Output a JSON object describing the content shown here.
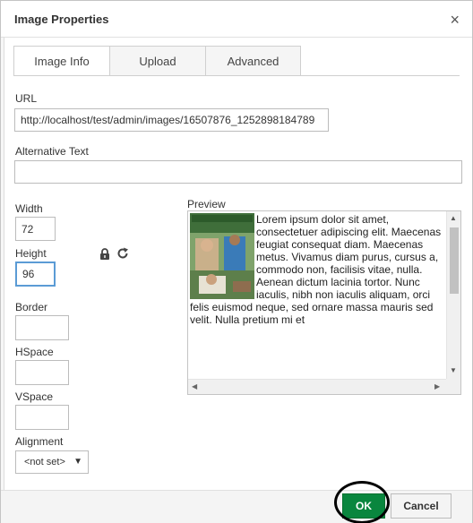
{
  "dialog": {
    "title": "Image Properties",
    "close_symbol": "×"
  },
  "tabs": [
    {
      "label": "Image Info",
      "active": true
    },
    {
      "label": "Upload",
      "active": false
    },
    {
      "label": "Advanced",
      "active": false
    }
  ],
  "form": {
    "url_label": "URL",
    "url_value": "http://localhost/test/admin/images/16507876_1252898184789",
    "alt_label": "Alternative Text",
    "alt_value": "",
    "width_label": "Width",
    "width_value": "72",
    "height_label": "Height",
    "height_value": "96",
    "border_label": "Border",
    "border_value": "",
    "hspace_label": "HSpace",
    "hspace_value": "",
    "vspace_label": "VSpace",
    "vspace_value": "",
    "alignment_label": "Alignment",
    "alignment_value": "<not set>"
  },
  "preview": {
    "label": "Preview",
    "text": "Lorem ipsum dolor sit amet, consectetuer adipiscing elit. Maecenas feugiat consequat diam. Maecenas metus. Vivamus diam purus, cursus a, commodo non, facilisis vitae, nulla. Aenean dictum lacinia tortor. Nunc iaculis, nibh non iaculis aliquam, orci felis euismod neque, sed ornare massa mauris sed velit. Nulla pretium mi et"
  },
  "footer": {
    "ok_label": "OK",
    "cancel_label": "Cancel"
  },
  "colors": {
    "ok_button": "#09863e",
    "focus_border": "#5b9bd5"
  },
  "icons": [
    "lock-icon",
    "reset-size-icon",
    "close-icon",
    "dropdown-arrow-icon"
  ]
}
